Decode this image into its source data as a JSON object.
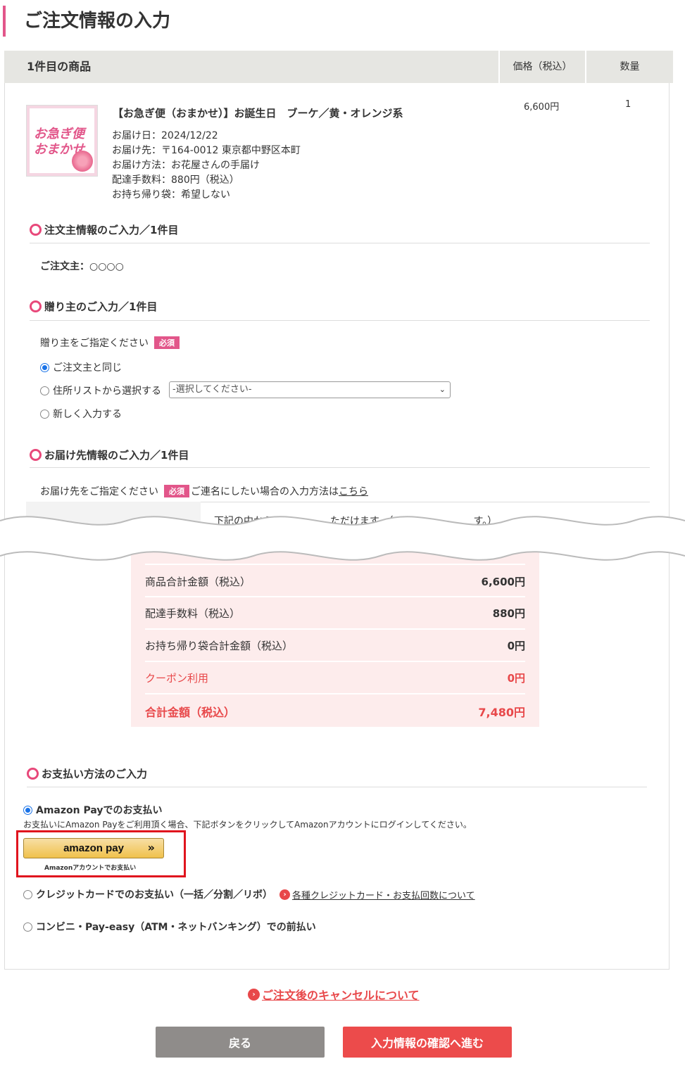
{
  "page_title": "ご注文情報の入力",
  "product_header": {
    "name": "1件目の商品",
    "price": "価格（税込）",
    "qty": "数量"
  },
  "product": {
    "thumb_text_1": "お急ぎ便",
    "thumb_text_2": "おまかせ",
    "name": "【お急ぎ便（おまかせ）】お誕生日　ブーケ／黄・オレンジ系",
    "details": [
      "お届け日：2024/12/22",
      "お届け先：〒164-0012 東京都中野区本町",
      "お届け方法：お花屋さんの手届け",
      "配達手数料：880円（税込）",
      "お持ち帰り袋：希望しない"
    ],
    "price": "6,600円",
    "qty": "1"
  },
  "orderer": {
    "title": "注文主情報のご入力／1件目",
    "label": "ご注文主：○○○○"
  },
  "sender": {
    "title": "贈り主のご入力／1件目",
    "prompt": "贈り主をご指定ください",
    "required": "必須",
    "options": [
      "ご注文主と同じ",
      "住所リストから選択する",
      "新しく入力する"
    ],
    "select_placeholder": "-選択してください-"
  },
  "delivery": {
    "title": "お届け先情報のご入力／1件目",
    "prompt": "お届け先をご指定ください",
    "required": "必須",
    "joint_text": "ご連名にしたい場合の入力方法は",
    "joint_link": "こちら",
    "hint_start": "下記の中から",
    "hint_mid": "ただけます。（い",
    "hint_end": "す。）"
  },
  "summary": {
    "rows": [
      {
        "label": "商品合計金額（税込）",
        "value": "6,600円"
      },
      {
        "label": "配達手数料（税込）",
        "value": "880円"
      },
      {
        "label": "お持ち帰り袋合計金額（税込）",
        "value": "0円"
      },
      {
        "label": "クーポン利用",
        "value": "0円"
      },
      {
        "label": "合計金額（税込）",
        "value": "7,480円"
      }
    ]
  },
  "payment": {
    "title": "お支払い方法のご入力",
    "amazon_label": "Amazon Payでのお支払い",
    "amazon_desc": "お支払いにAmazon Payをご利用頂く場合、下記ボタンをクリックしてAmazonアカウントにログインしてください。",
    "amazon_logo": "amazon pay",
    "amazon_sub": "Amazonアカウントでお支払い",
    "card_label": "クレジットカードでのお支払い（一括／分割／リボ）",
    "card_link": "各種クレジットカード・お支払回数について",
    "conv_label": "コンビニ・Pay-easy（ATM・ネットバンキング）での前払い"
  },
  "cancel_link": "ご注文後のキャンセルについて",
  "buttons": {
    "back": "戻る",
    "next": "入力情報の確認へ進む"
  },
  "colors": {
    "accent": "#e2568a",
    "red": "#e8484a",
    "summary_bg": "#fdecec"
  }
}
